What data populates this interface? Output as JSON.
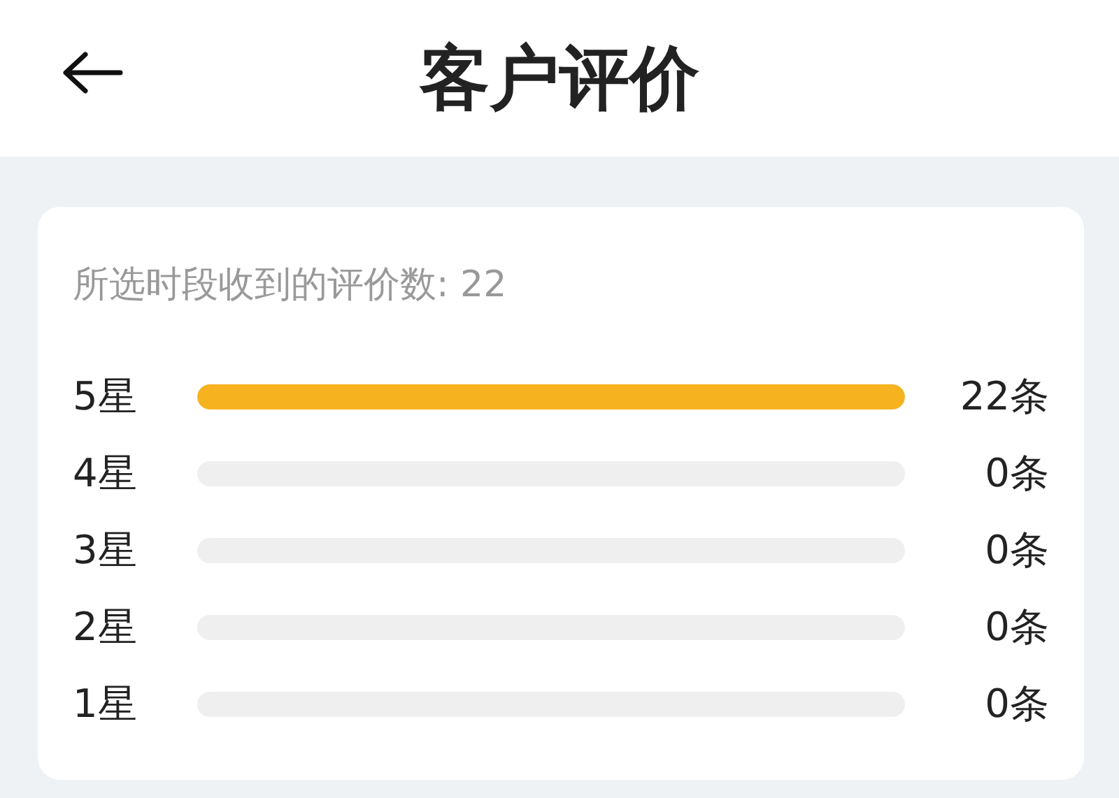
{
  "header": {
    "title": "客户评价"
  },
  "summary": "所选时段收到的评价数: 22",
  "ratings": [
    {
      "label": "5星",
      "level": 1,
      "count": "22条"
    },
    {
      "label": "4星",
      "count": "0条"
    },
    {
      "label": "3星",
      "count": "0条"
    },
    {
      "label": "2星",
      "count": "0条"
    },
    {
      "label": "1星",
      "count": "0条"
    }
  ]
}
